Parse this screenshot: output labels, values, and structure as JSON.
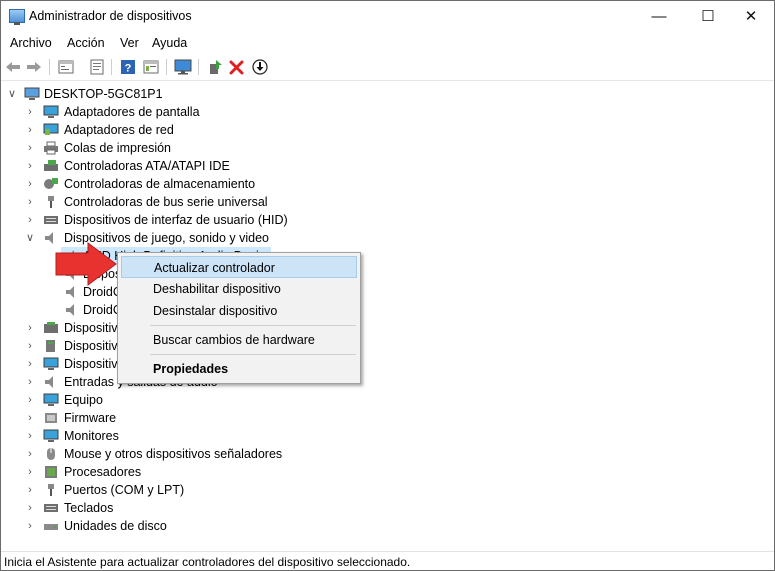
{
  "window": {
    "title": "Administrador de dispositivos"
  },
  "window_controls": {
    "minimize": "—",
    "maximize": "☐",
    "close": "✕"
  },
  "menubar": [
    "Archivo",
    "Acción",
    "Ver",
    "Ayuda"
  ],
  "toolbar": [
    "back-icon",
    "forward-icon",
    "device-tree-icon",
    "properties-icon",
    "help-icon",
    "view-icon",
    "monitor-icon",
    "update-driver-icon",
    "uninstall-icon",
    "download-icon"
  ],
  "tree": {
    "root": "DESKTOP-5GC81P1",
    "categories": [
      {
        "label": "Adaptadores de pantalla"
      },
      {
        "label": "Adaptadores de red"
      },
      {
        "label": "Colas de impresión"
      },
      {
        "label": "Controladoras ATA/ATAPI IDE"
      },
      {
        "label": "Controladoras de almacenamiento"
      },
      {
        "label": "Controladoras de bus serie universal"
      },
      {
        "label": "Dispositivos de interfaz de usuario (HID)"
      },
      {
        "label": "Dispositivos de juego, sonido y video",
        "expanded": true
      },
      {
        "label": "Dispositivo"
      },
      {
        "label": "Dispositivo"
      },
      {
        "label": "Dispositivo"
      },
      {
        "label": "Entradas y salidas de audio"
      },
      {
        "label": "Equipo"
      },
      {
        "label": "Firmware"
      },
      {
        "label": "Monitores"
      },
      {
        "label": "Mouse y otros dispositivos señaladores"
      },
      {
        "label": "Procesadores"
      },
      {
        "label": "Puertos (COM y LPT)"
      },
      {
        "label": "Teclados"
      },
      {
        "label": "Unidades de disco"
      }
    ],
    "children": [
      {
        "label": "AMD High Definition Audio Device",
        "selected": true
      },
      {
        "label": "Dispos"
      },
      {
        "label": "DroidC"
      },
      {
        "label": "DroidC"
      }
    ]
  },
  "context_menu": {
    "items": [
      {
        "label": "Actualizar controlador",
        "highlighted": true
      },
      {
        "label": "Deshabilitar dispositivo"
      },
      {
        "label": "Desinstalar dispositivo"
      },
      {
        "label": "Buscar cambios de hardware"
      },
      {
        "label": "Propiedades",
        "bold": true
      }
    ]
  },
  "statusbar": {
    "text": "Inicia el Asistente para actualizar controladores del dispositivo seleccionado."
  },
  "colors": {
    "highlight": "#cde4f7",
    "selection": "#cce8ff",
    "arrow": "#e8322f"
  }
}
